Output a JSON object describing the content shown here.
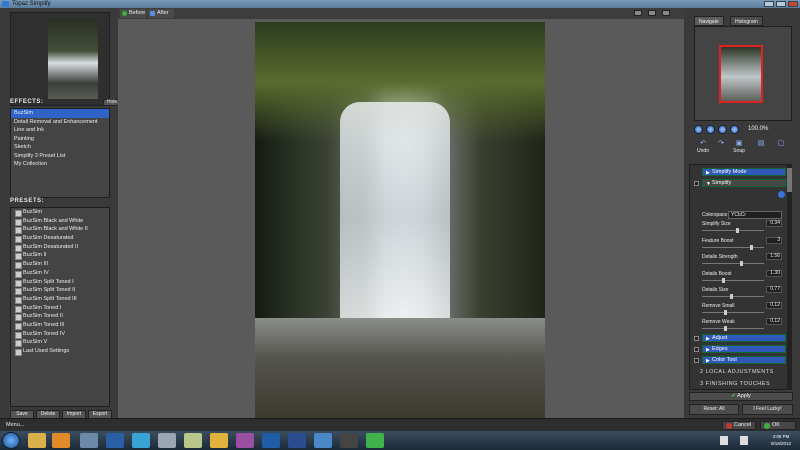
{
  "window": {
    "title": "Topaz Simplify"
  },
  "left": {
    "hide_label": "Hide",
    "effects_heading": "EFFECTS:",
    "effects": [
      "BuzSim",
      "Detail Removal and Enhancement",
      "Line and Ink",
      "Painting",
      "Sketch",
      "Simplify 3 Preset List",
      "My Collection"
    ],
    "presets_heading": "PRESETS:",
    "presets": [
      "BuzSim",
      "BuzSim Black and White",
      "BuzSim Black and White II",
      "BuzSim Desaturated",
      "BuzSim Desaturated II",
      "BuzSim II",
      "BuzSim III",
      "BuzSim IV",
      "BuzSim Split Toned I",
      "BuzSim Split Toned II",
      "BuzSim Split Toned III",
      "BuzSim Toned I",
      "BuzSim Toned II",
      "BuzSim Toned III",
      "BuzSim Toned IV",
      "BuzSim V",
      "Last Used Settings"
    ],
    "buttons": [
      "Save",
      "Delete",
      "Import",
      "Export"
    ]
  },
  "center": {
    "tab_before": "Before",
    "tab_after": "After"
  },
  "right": {
    "tab_navigate": "Navigate",
    "tab_histogram": "Histogram",
    "zoom": "100.0%",
    "tools": [
      "Undo",
      "Snap"
    ],
    "simplify_mode": "Simplify Mode",
    "simplify": "Simplify",
    "colorspace_label": "Colorspace",
    "colorspace_value": "YCbCr",
    "sliders": [
      {
        "label": "Simplify Size",
        "value": "0.34"
      },
      {
        "label": "Feature Boost",
        "value": "3"
      },
      {
        "label": "Details Strength",
        "value": "1.56"
      },
      {
        "label": "Details Boost",
        "value": "1.30"
      },
      {
        "label": "Details Size",
        "value": "0.77"
      },
      {
        "label": "Remove Small",
        "value": "0.12"
      },
      {
        "label": "Remove Weak",
        "value": "0.12"
      }
    ],
    "adjust": "Adjust",
    "edges": "Edges",
    "color_tool": "Color Tool",
    "local_adjustments": "2 LOCAL ADJUSTMENTS",
    "finishing_touches": "3 FINISHING TOUCHES",
    "apply": "Apply",
    "reset": "Reset: All",
    "lucky": "I Feel Lucky!"
  },
  "bottom": {
    "menu": "Menu...",
    "cancel": "Cancel",
    "ok": "OK"
  },
  "taskbar": {
    "time": "4:05 PM",
    "date": "9/18/2012"
  }
}
